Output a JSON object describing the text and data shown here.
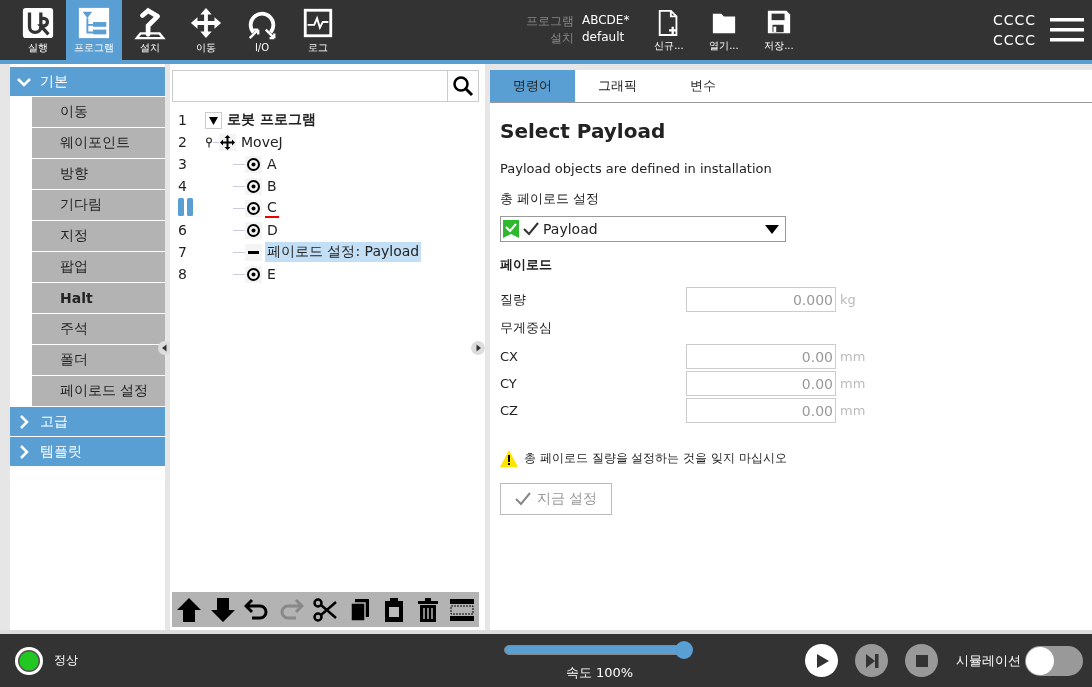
{
  "header": {
    "nav_tabs": [
      {
        "kind": "logo",
        "label": "실행",
        "selected": false
      },
      {
        "kind": "program",
        "label": "프로그램",
        "selected": true
      },
      {
        "kind": "install",
        "label": "설치",
        "selected": false
      },
      {
        "kind": "move",
        "label": "이동",
        "selected": false
      },
      {
        "kind": "io",
        "label": "I/O",
        "selected": false
      },
      {
        "kind": "log",
        "label": "로그",
        "selected": false
      }
    ],
    "program_label": "프로그램",
    "program_value": "ABCDE*",
    "installation_label": "설치",
    "installation_value": "default",
    "file_buttons": [
      {
        "kind": "new",
        "label": "신규..."
      },
      {
        "kind": "open",
        "label": "열기..."
      },
      {
        "kind": "save",
        "label": "저장..."
      }
    ],
    "user_lines": [
      "CCCC",
      "CCCC"
    ]
  },
  "sidebar": {
    "groups": [
      {
        "label": "기본",
        "expanded": true,
        "items": [
          {
            "label": "이동",
            "emphasized": false
          },
          {
            "label": "웨이포인트",
            "emphasized": false
          },
          {
            "label": "방향",
            "emphasized": false
          },
          {
            "label": "기다림",
            "emphasized": false
          },
          {
            "label": "지정",
            "emphasized": false
          },
          {
            "label": "팝업",
            "emphasized": false
          },
          {
            "label": "Halt",
            "emphasized": true
          },
          {
            "label": "주석",
            "emphasized": false
          },
          {
            "label": "폴더",
            "emphasized": false
          },
          {
            "label": "페이로드 설정",
            "emphasized": false
          }
        ]
      },
      {
        "label": "고급",
        "expanded": false
      },
      {
        "label": "템플릿",
        "expanded": false
      }
    ]
  },
  "tree": {
    "nodes": [
      {
        "line": "1",
        "label": "로봇 프로그램",
        "kind": "root",
        "expanded": true,
        "selected": false,
        "current": false,
        "flagged": false,
        "children": [
          {
            "line": "2",
            "label": "MoveJ",
            "kind": "move",
            "selected": false,
            "current": false,
            "flagged": false,
            "children": [
              {
                "line": "3",
                "label": "A",
                "kind": "waypoint",
                "selected": false,
                "current": false,
                "flagged": false
              },
              {
                "line": "4",
                "label": "B",
                "kind": "waypoint",
                "selected": false,
                "current": false,
                "flagged": false
              },
              {
                "label": "C",
                "kind": "waypoint",
                "selected": false,
                "current": true,
                "flagged": true
              },
              {
                "line": "6",
                "label": "D",
                "kind": "waypoint",
                "selected": false,
                "current": false,
                "flagged": false
              },
              {
                "line": "7",
                "label": "페이로드 설정: Payload",
                "kind": "payload",
                "selected": true,
                "current": false,
                "flagged": false
              },
              {
                "line": "8",
                "label": "E",
                "kind": "waypoint",
                "selected": false,
                "current": false,
                "flagged": false
              }
            ]
          }
        ]
      }
    ]
  },
  "editor": {
    "tabs": [
      {
        "label": "명령어",
        "selected": true
      },
      {
        "label": "그래픽",
        "selected": false
      },
      {
        "label": "변수",
        "selected": false
      }
    ],
    "title": "Select Payload",
    "description": "Payload objects are defined in installation",
    "payload_select": {
      "label": "총 페이로드 설정",
      "value": "Payload",
      "valid": true
    },
    "section": "페이로드",
    "mass": {
      "label": "질량",
      "value": "0.000",
      "unit": "kg"
    },
    "cog_label": "무게중심",
    "cog": [
      {
        "label": "CX",
        "value": "0.00",
        "unit": "mm"
      },
      {
        "label": "CY",
        "value": "0.00",
        "unit": "mm"
      },
      {
        "label": "CZ",
        "value": "0.00",
        "unit": "mm"
      }
    ],
    "warning": "총 페이로드 질량을 설정하는 것을 잊지 마십시오",
    "set_button": {
      "label": "지금 설정",
      "disabled": true
    }
  },
  "footer": {
    "status": "정상",
    "speed": {
      "label": "속도 100%",
      "level": 1.0
    },
    "controls": [
      {
        "kind": "play",
        "disabled": false
      },
      {
        "kind": "step",
        "disabled": true
      },
      {
        "kind": "stop",
        "disabled": true
      }
    ],
    "simulation": {
      "label": "시뮬레이션",
      "on": false
    }
  }
}
